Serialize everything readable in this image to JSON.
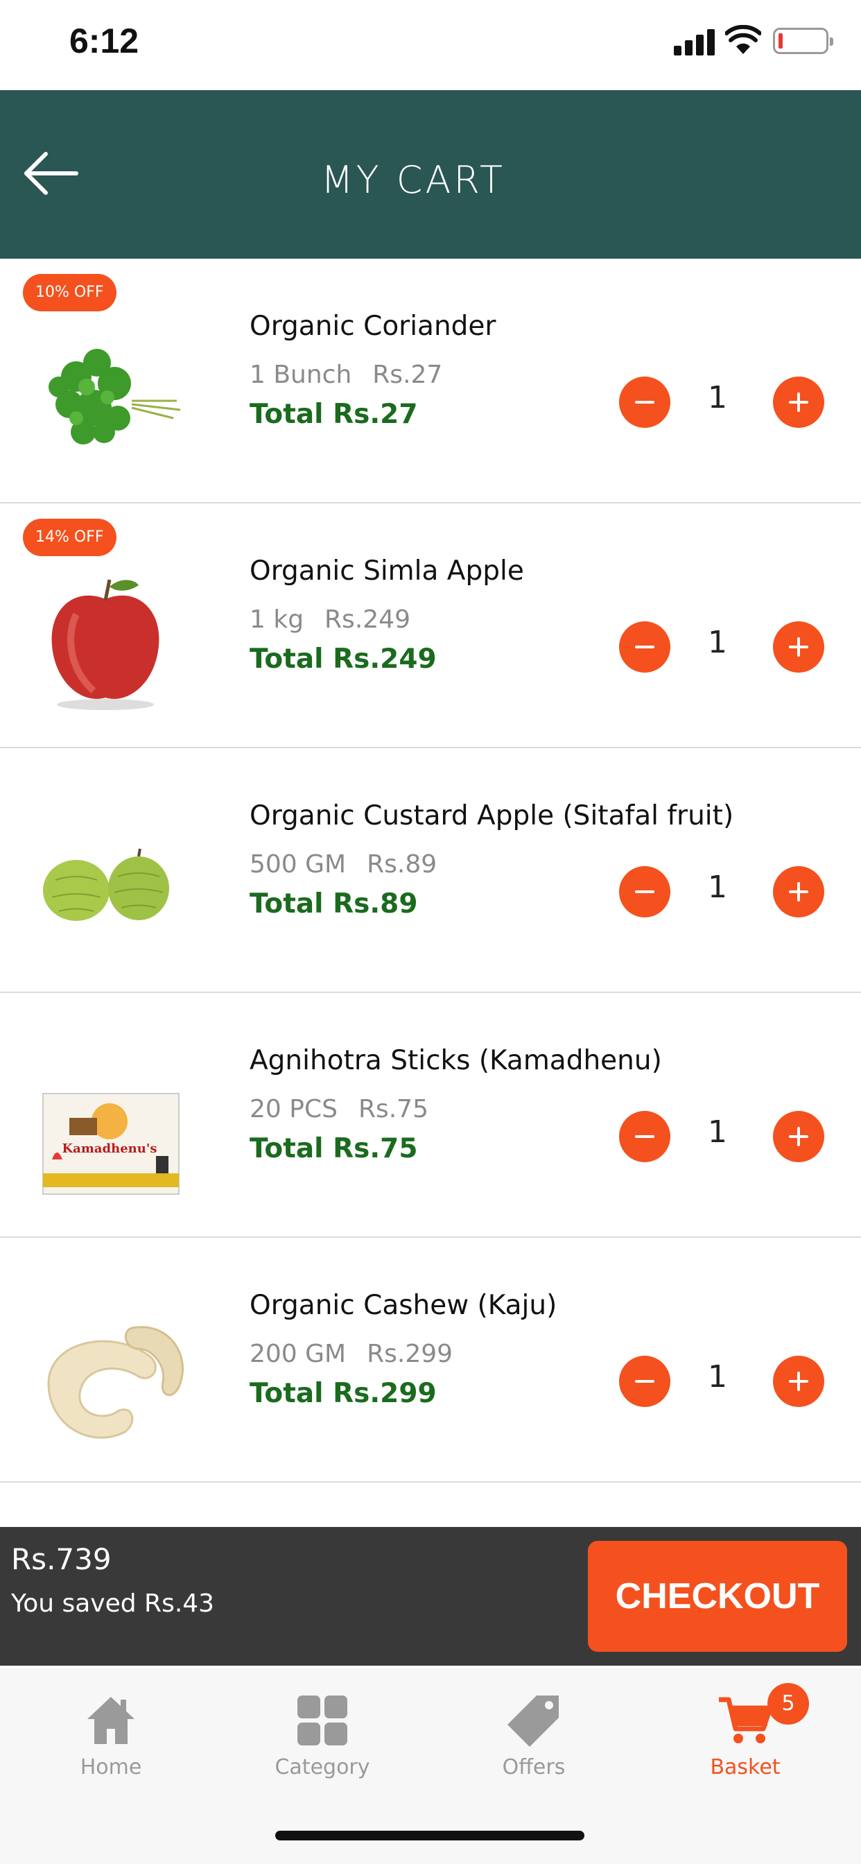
{
  "status_bar": {
    "time": "6:12"
  },
  "header": {
    "title": "MY CART"
  },
  "cart": {
    "items": [
      {
        "discount": "10% OFF",
        "name": "Organic Coriander",
        "unit": "1 Bunch",
        "price": "Rs.27",
        "total": "Total Rs.27",
        "quantity": "1"
      },
      {
        "discount": "14% OFF",
        "name": "Organic Simla Apple",
        "unit": "1 kg",
        "price": "Rs.249",
        "total": "Total Rs.249",
        "quantity": "1"
      },
      {
        "discount": "",
        "name": "Organic Custard Apple (Sitafal fruit)",
        "unit": "500 GM",
        "price": "Rs.89",
        "total": "Total Rs.89",
        "quantity": "1"
      },
      {
        "discount": "",
        "name": "Agnihotra Sticks (Kamadhenu)",
        "unit": "20 PCS",
        "price": "Rs.75",
        "total": "Total Rs.75",
        "quantity": "1"
      },
      {
        "discount": "",
        "name": "Organic Cashew (Kaju)",
        "unit": "200 GM",
        "price": "Rs.299",
        "total": "Total Rs.299",
        "quantity": "1"
      }
    ],
    "package_brand": "Kamadhenu's"
  },
  "checkout": {
    "total": "Rs.739",
    "saved": "You saved Rs.43",
    "button_label": "CHECKOUT"
  },
  "bottom_nav": {
    "items": [
      {
        "label": "Home",
        "icon": "home-icon"
      },
      {
        "label": "Category",
        "icon": "grid-icon"
      },
      {
        "label": "Offers",
        "icon": "tag-icon"
      },
      {
        "label": "Basket",
        "icon": "cart-icon"
      }
    ],
    "basket_count": "5"
  },
  "colors": {
    "header": "#2a5653",
    "accent": "#f4511e",
    "total_green": "#1b6b1e",
    "checkout_bar": "#393939"
  }
}
